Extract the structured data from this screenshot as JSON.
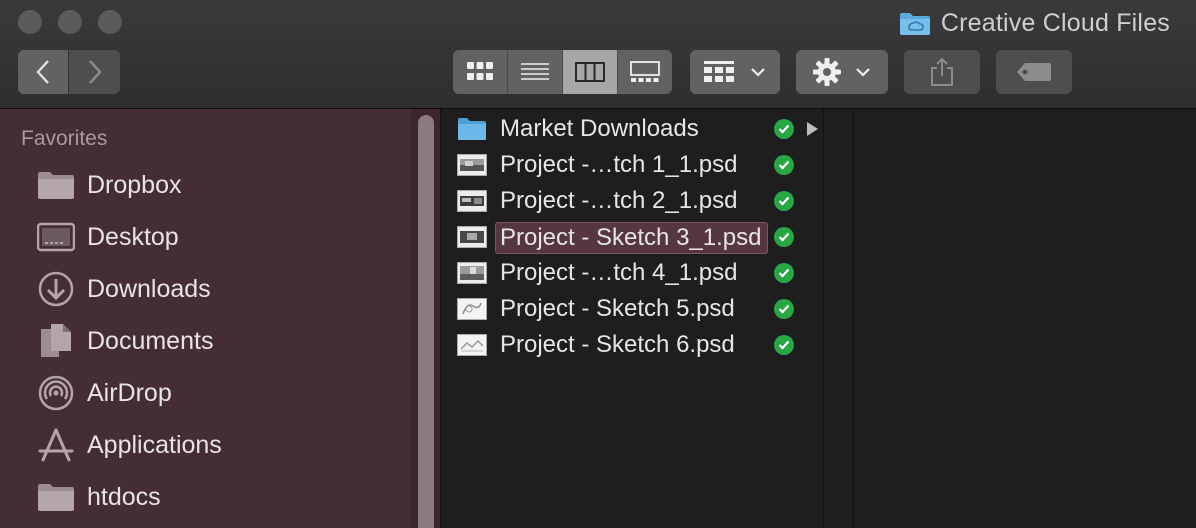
{
  "window": {
    "title": "Creative Cloud Files"
  },
  "toolbar": {
    "view_modes": [
      "icon-view",
      "list-view",
      "column-view",
      "gallery-view"
    ],
    "active_view": "column-view"
  },
  "sidebar": {
    "heading": "Favorites",
    "items": [
      {
        "label": "Dropbox",
        "icon": "folder-icon"
      },
      {
        "label": "Desktop",
        "icon": "desktop-icon"
      },
      {
        "label": "Downloads",
        "icon": "downloads-icon"
      },
      {
        "label": "Documents",
        "icon": "documents-icon"
      },
      {
        "label": "AirDrop",
        "icon": "airdrop-icon"
      },
      {
        "label": "Applications",
        "icon": "applications-icon"
      },
      {
        "label": "htdocs",
        "icon": "folder-icon"
      }
    ]
  },
  "files": [
    {
      "name": "Market Downloads",
      "type": "folder",
      "synced": true
    },
    {
      "name": "Project -…tch 1_1.psd",
      "type": "psd",
      "synced": true
    },
    {
      "name": "Project -…tch 2_1.psd",
      "type": "psd",
      "synced": true
    },
    {
      "name": "Project - Sketch 3_1.psd",
      "type": "psd",
      "synced": true,
      "selected": true
    },
    {
      "name": "Project -…tch 4_1.psd",
      "type": "psd",
      "synced": true
    },
    {
      "name": "Project - Sketch 5.psd",
      "type": "psd",
      "synced": true
    },
    {
      "name": "Project - Sketch 6.psd",
      "type": "psd",
      "synced": true
    }
  ],
  "colors": {
    "sidebar_bg": "#442d35",
    "sync_check": "#29a744",
    "folder_blue": "#5aa9dd"
  }
}
